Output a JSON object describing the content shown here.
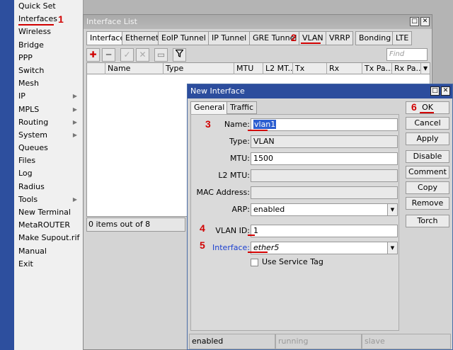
{
  "sidebar": {
    "items": [
      {
        "label": "Quick Set",
        "arrow": false
      },
      {
        "label": "Interfaces",
        "arrow": false
      },
      {
        "label": "Wireless",
        "arrow": false
      },
      {
        "label": "Bridge",
        "arrow": false
      },
      {
        "label": "PPP",
        "arrow": false
      },
      {
        "label": "Switch",
        "arrow": false
      },
      {
        "label": "Mesh",
        "arrow": false
      },
      {
        "label": "IP",
        "arrow": true
      },
      {
        "label": "MPLS",
        "arrow": true
      },
      {
        "label": "Routing",
        "arrow": true
      },
      {
        "label": "System",
        "arrow": true
      },
      {
        "label": "Queues",
        "arrow": false
      },
      {
        "label": "Files",
        "arrow": false
      },
      {
        "label": "Log",
        "arrow": false
      },
      {
        "label": "Radius",
        "arrow": false
      },
      {
        "label": "Tools",
        "arrow": true
      },
      {
        "label": "New Terminal",
        "arrow": false
      },
      {
        "label": "MetaROUTER",
        "arrow": false
      },
      {
        "label": "Make Supout.rif",
        "arrow": false
      },
      {
        "label": "Manual",
        "arrow": false
      },
      {
        "label": "Exit",
        "arrow": false
      }
    ]
  },
  "annotations": [
    "1",
    "2",
    "3",
    "4",
    "5",
    "6"
  ],
  "interface_list": {
    "title": "Interface List",
    "tabs": [
      "Interface",
      "Ethernet",
      "EoIP Tunnel",
      "IP Tunnel",
      "GRE Tunnel",
      "VLAN",
      "VRRP",
      "Bonding",
      "LTE"
    ],
    "find_placeholder": "Find",
    "columns": [
      "Name",
      "Type",
      "MTU",
      "L2 MT...",
      "Tx",
      "Rx",
      "Tx Pa...",
      "Rx Pa..."
    ],
    "items_count": "0 items out of 8"
  },
  "dialog": {
    "title": "New Interface",
    "tabs": [
      "General",
      "Traffic"
    ],
    "fields": {
      "name_label": "Name:",
      "name_value": "vlan1",
      "type_label": "Type:",
      "type_value": "VLAN",
      "mtu_label": "MTU:",
      "mtu_value": "1500",
      "l2mtu_label": "L2 MTU:",
      "mac_label": "MAC Address:",
      "arp_label": "ARP:",
      "arp_value": "enabled",
      "vlanid_label": "VLAN ID:",
      "vlanid_value": "1",
      "interface_label": "Interface:",
      "interface_value": "ether5",
      "service_tag_label": "Use Service Tag"
    },
    "buttons": [
      "OK",
      "Cancel",
      "Apply",
      "Disable",
      "Comment",
      "Copy",
      "Remove",
      "Torch"
    ],
    "status": [
      "enabled",
      "running",
      "slave"
    ]
  },
  "colors": {
    "annotation": "#d10000",
    "active_title": "#2c4d9d",
    "inactive_title": "#a9a9a9",
    "interface_label": "#1a3fd0"
  }
}
